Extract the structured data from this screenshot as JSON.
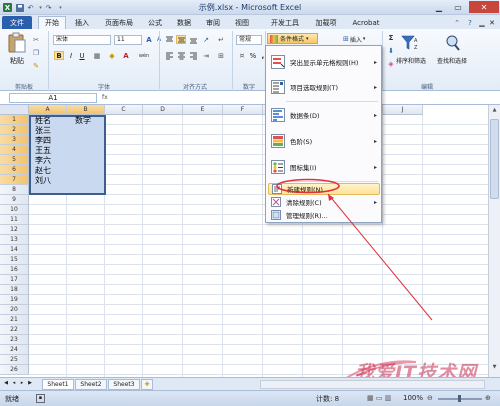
{
  "window": {
    "title": "示例.xlsx - Microsoft Excel"
  },
  "ribbon_tabs": [
    "文件",
    "开始",
    "插入",
    "页面布局",
    "公式",
    "数据",
    "审阅",
    "视图",
    "开发工具",
    "加载项",
    "Acrobat"
  ],
  "clipboard": {
    "paste": "粘贴",
    "group": "剪贴板"
  },
  "font": {
    "name": "宋体",
    "size": "11",
    "bold": "B",
    "italic": "I",
    "underline": "U",
    "color_btn": "A",
    "wen": "wén",
    "group": "字体"
  },
  "alignment": {
    "group": "对齐方式"
  },
  "number": {
    "format": "常规",
    "pct": "%",
    "comma": ",",
    "group": "数字"
  },
  "styles": {
    "cond_format": "条件格式"
  },
  "cells": {
    "insert": "插入"
  },
  "editing": {
    "sigma": "Σ",
    "sort": "排序和筛选",
    "find": "查找和选择",
    "group": "编辑"
  },
  "formula": {
    "namebox": "A1",
    "fx": "fx"
  },
  "columns": [
    "A",
    "B",
    "C",
    "D",
    "E",
    "F",
    "G",
    "H",
    "I",
    "J"
  ],
  "rows": [
    "1",
    "2",
    "3",
    "4",
    "5",
    "6",
    "7",
    "8",
    "9",
    "10",
    "11",
    "12",
    "13",
    "14",
    "15",
    "16",
    "17",
    "18",
    "19",
    "20",
    "21",
    "22",
    "23",
    "24",
    "25",
    "26"
  ],
  "table": {
    "header": [
      "姓名",
      "数学"
    ],
    "names": [
      "张三",
      "李四",
      "王五",
      "李六",
      "赵七",
      "刘八"
    ]
  },
  "menu": {
    "items": [
      "突出显示单元格规则(H)",
      "项目选取规则(T)",
      "数据条(D)",
      "色阶(S)",
      "图标集(I)"
    ],
    "new_rule": "新建规则(N)...",
    "clear_rule": "清除规则(C)",
    "manage_rule": "管理规则(R)..."
  },
  "sheets": [
    "Sheet1",
    "Sheet2",
    "Sheet3"
  ],
  "status": {
    "ready": "就绪",
    "count": "计数: 8",
    "zoom": "100%"
  },
  "watermark": {
    "text": "我爱IT技术网"
  },
  "colors": {
    "accent": "#2a5fae",
    "selection": "#c9d9f0",
    "highlight": "#fde39a",
    "annotation": "#e0303a"
  }
}
